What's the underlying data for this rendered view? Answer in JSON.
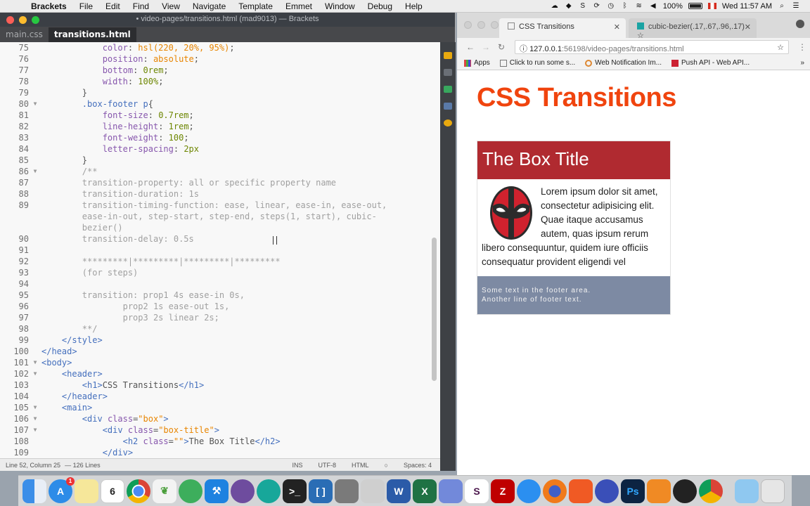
{
  "menubar": {
    "app_name": "Brackets",
    "items": [
      "File",
      "Edit",
      "Find",
      "View",
      "Navigate",
      "Template",
      "Emmet",
      "Window",
      "Debug",
      "Help"
    ],
    "battery": "100%",
    "clock": "Wed 11:57 AM"
  },
  "brackets": {
    "window_title": "• video-pages/transitions.html (mad9013) — Brackets",
    "tabs": [
      {
        "label": "main.css",
        "active": false
      },
      {
        "label": "transitions.html",
        "active": true
      }
    ],
    "statusbar": {
      "position": "Line 52, Column 25",
      "lines": "— 126 Lines",
      "mode": "INS",
      "encoding": "UTF-8",
      "language": "HTML",
      "spaces": "Spaces: 4"
    }
  },
  "code_lines": [
    {
      "n": "75",
      "fold": "",
      "html": "            <span class=\"c-prop\">color</span>: <span class=\"c-val\">hsl(220, 20%, 95%)</span>;"
    },
    {
      "n": "76",
      "fold": "",
      "html": "            <span class=\"c-prop\">position</span>: <span class=\"c-val\">absolute</span>;"
    },
    {
      "n": "77",
      "fold": "",
      "html": "            <span class=\"c-prop\">bottom</span>: <span class=\"c-num\">0rem</span>;"
    },
    {
      "n": "78",
      "fold": "",
      "html": "            <span class=\"c-prop\">width</span>: <span class=\"c-num\">100%</span>;"
    },
    {
      "n": "79",
      "fold": "",
      "html": "        }"
    },
    {
      "n": "80",
      "fold": "▼",
      "html": "        <span class=\"c-sel\">.box-footer p</span>{"
    },
    {
      "n": "81",
      "fold": "",
      "html": "            <span class=\"c-prop\">font-size</span>: <span class=\"c-num\">0.7rem</span>;"
    },
    {
      "n": "82",
      "fold": "",
      "html": "            <span class=\"c-prop\">line-height</span>: <span class=\"c-num\">1rem</span>;"
    },
    {
      "n": "83",
      "fold": "",
      "html": "            <span class=\"c-prop\">font-weight</span>: <span class=\"c-num\">100</span>;"
    },
    {
      "n": "84",
      "fold": "",
      "html": "            <span class=\"c-prop\">letter-spacing</span>: <span class=\"c-num\">2px</span>"
    },
    {
      "n": "85",
      "fold": "",
      "html": "        }"
    },
    {
      "n": "86",
      "fold": "▼",
      "html": "        <span class=\"c-cmt\">/**</span>"
    },
    {
      "n": "87",
      "fold": "",
      "html": "        <span class=\"c-cmt\">transition-property: all or specific property name</span>"
    },
    {
      "n": "88",
      "fold": "",
      "html": "        <span class=\"c-cmt\">transition-duration: 1s</span>"
    },
    {
      "n": "89",
      "fold": "",
      "html": "        <span class=\"c-cmt\">transition-timing-function: ease, linear, ease-in, ease-out,</span>"
    },
    {
      "n": "",
      "fold": "",
      "html": "        <span class=\"c-cmt\">ease-in-out, step-start, step-end, steps(1, start), cubic-</span>"
    },
    {
      "n": "",
      "fold": "",
      "html": "        <span class=\"c-cmt\">bezier()</span>"
    },
    {
      "n": "90",
      "fold": "",
      "html": "        <span class=\"c-cmt\">transition-delay: 0.5s</span>"
    },
    {
      "n": "91",
      "fold": "",
      "html": ""
    },
    {
      "n": "92",
      "fold": "",
      "html": "        <span class=\"c-cmt\">*********|*********|*********|*********</span>"
    },
    {
      "n": "93",
      "fold": "",
      "html": "        <span class=\"c-cmt\">(for steps)</span>"
    },
    {
      "n": "94",
      "fold": "",
      "html": ""
    },
    {
      "n": "95",
      "fold": "",
      "html": "        <span class=\"c-cmt\">transition: prop1 4s ease-in 0s,</span>"
    },
    {
      "n": "96",
      "fold": "",
      "html": "                <span class=\"c-cmt\">prop2 1s ease-out 1s,</span>"
    },
    {
      "n": "97",
      "fold": "",
      "html": "                <span class=\"c-cmt\">prop3 2s linear 2s;</span>"
    },
    {
      "n": "98",
      "fold": "",
      "html": "        <span class=\"c-cmt\">**/</span>"
    },
    {
      "n": "99",
      "fold": "",
      "html": "    <span class=\"c-tag\">&lt;/style&gt;</span>"
    },
    {
      "n": "100",
      "fold": "",
      "html": "<span class=\"c-tag\">&lt;/head&gt;</span>"
    },
    {
      "n": "101",
      "fold": "▼",
      "html": "<span class=\"c-tag\">&lt;body&gt;</span>"
    },
    {
      "n": "102",
      "fold": "▼",
      "html": "    <span class=\"c-tag\">&lt;header&gt;</span>"
    },
    {
      "n": "103",
      "fold": "",
      "html": "        <span class=\"c-tag\">&lt;h1&gt;</span>CSS Transitions<span class=\"c-tag\">&lt;/h1&gt;</span>"
    },
    {
      "n": "104",
      "fold": "",
      "html": "    <span class=\"c-tag\">&lt;/header&gt;</span>"
    },
    {
      "n": "105",
      "fold": "▼",
      "html": "    <span class=\"c-tag\">&lt;main&gt;</span>"
    },
    {
      "n": "106",
      "fold": "▼",
      "html": "        <span class=\"c-tag\">&lt;div</span> <span class=\"c-prop\">class</span>=<span class=\"c-str\">\"box\"</span><span class=\"c-tag\">&gt;</span>"
    },
    {
      "n": "107",
      "fold": "▼",
      "html": "            <span class=\"c-tag\">&lt;div</span> <span class=\"c-prop\">class</span>=<span class=\"c-str\">\"box-title\"</span><span class=\"c-tag\">&gt;</span>"
    },
    {
      "n": "108",
      "fold": "",
      "html": "                <span class=\"c-tag\">&lt;h2</span> <span class=\"c-prop\">class</span>=<span class=\"c-str\">\"\"</span><span class=\"c-tag\">&gt;</span>The Box Title<span class=\"c-tag\">&lt;/h2&gt;</span>"
    },
    {
      "n": "109",
      "fold": "",
      "html": "            <span class=\"c-tag\">&lt;/div&gt;</span>"
    }
  ],
  "chrome": {
    "tabs": [
      {
        "label": "CSS Transitions",
        "active": true
      },
      {
        "label": "cubic-bezier(.17,.67,.96,.17) ☆",
        "active": false
      }
    ],
    "url_host": "127.0.0.1",
    "url_path": ":56198/video-pages/transitions.html",
    "bookmarks": [
      "Apps",
      "Click to run some s...",
      "Web Notification Im...",
      "Push API - Web API..."
    ],
    "more": "»"
  },
  "page": {
    "heading": "CSS Transitions",
    "box_title": "The Box Title",
    "box_body": "Lorem ipsum dolor sit amet, consectetur adipisicing elit. Quae itaque accusamus autem, quas ipsum rerum libero consequuntur, quidem iure officiis consequatur provident eligendi vel",
    "footer_line1": "Some text in the footer area.",
    "footer_line2": "Another line of footer text."
  },
  "colors": {
    "heading": "#f0440e",
    "box_title_bg": "#b02a30",
    "footer_bg": "#7d8aa3"
  },
  "dock": {
    "calendar_day": "6",
    "badge": "1",
    "apps": [
      "finder",
      "app-store",
      "notes",
      "calendar",
      "chrome",
      "mongodb",
      "android-studio",
      "xcode",
      "github",
      "gitkraken",
      "terminal",
      "brackets",
      "calculator",
      "sequel",
      "word",
      "excel",
      "discord",
      "slack",
      "filezilla",
      "safari",
      "firefox",
      "brave",
      "nightowl",
      "photoshop",
      "pencil",
      "obs",
      "chrome-canary",
      "downloads",
      "trash"
    ]
  }
}
